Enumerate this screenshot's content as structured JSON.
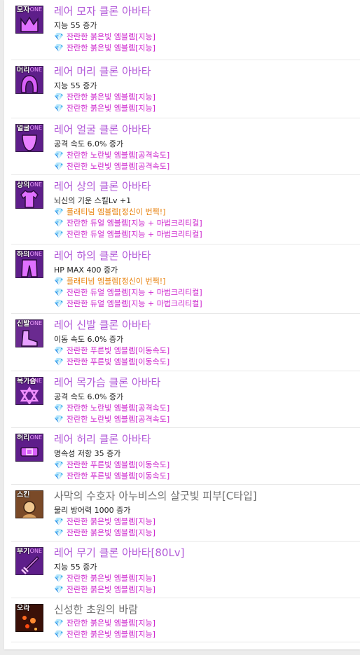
{
  "items": [
    {
      "tag": "모자",
      "name": "레어 모자 클론 아바타",
      "stat": "지능 55 증가",
      "emblems": [
        "잔란한 붉은빛 엠블렘[지능]",
        "잔란한 붉은빛 엠블렘[지능]"
      ],
      "gold": null,
      "glyph": "crown-icon",
      "gem": "pink"
    },
    {
      "tag": "머리",
      "name": "레어 머리 클론 아바타",
      "stat": "지능 55 증가",
      "emblems": [
        "잔란한 붉은빛 엠블렘[지능]",
        "잔란한 붉은빛 엠블렘[지능]"
      ],
      "gold": null,
      "glyph": "hair-icon",
      "gem": "pink"
    },
    {
      "tag": "얼굴",
      "name": "레어 얼굴 클론 아바타",
      "stat": "공격 속도 6.0% 증가",
      "emblems": [
        "찬란한 노란빛 엠블렘[공격속도]",
        "찬란한 노란빛 엠블렘[공격속도]"
      ],
      "gold": null,
      "glyph": "face-icon",
      "gem": "pink"
    },
    {
      "tag": "상의",
      "name": "레어 상의 클론 아바타",
      "stat": "뇌신의 기운 스킬Lv +1",
      "gold": "플래티넘 엠블렘[정신이 번쩍!]",
      "emblems": [
        "잔란한 듀얼 엠블렘[지능 + 마법크리티컬]",
        "잔란한 듀얼 엠블렘[지능 + 마법크리티컬]"
      ],
      "glyph": "shirt-icon",
      "gem": "pink"
    },
    {
      "tag": "하의",
      "name": "레어 하의 클론 아바타",
      "stat": "HP MAX 400 증가",
      "gold": "플래티넘 엠블렘[정신이 번쩍!]",
      "emblems": [
        "잔란한 듀얼 엠블렘[지능 + 마법크리티컬]",
        "잔란한 듀얼 엠블렘[지능 + 마법크리티컬]"
      ],
      "glyph": "pants-icon",
      "gem": "pink"
    },
    {
      "tag": "신발",
      "name": "레어 신발 클론 아바타",
      "stat": "이동 속도 6.0% 증가",
      "emblems": [
        "잔란한 푸른빛 엠블렘[이동속도]",
        "잔란한 푸른빛 엠블렘[이동속도]"
      ],
      "gold": null,
      "glyph": "shoes-icon",
      "gem": "pink"
    },
    {
      "tag": "목가슴",
      "name": "레어 목가슴 클론 아바타",
      "stat": "공격 속도 6.0% 증가",
      "emblems": [
        "잔란한 노란빛 엠블렘[공격속도]",
        "잔란한 노란빛 엠블렘[공격속도]"
      ],
      "gold": null,
      "glyph": "necklace-icon",
      "gem": "pink"
    },
    {
      "tag": "허리",
      "name": "레어 허리 클론 아바타",
      "stat": "명속성 저항 35 증가",
      "emblems": [
        "잔란한 푸른빛 엠블렘[이동속도]",
        "잔란한 푸른빛 엠블렘[이동속도]"
      ],
      "gold": null,
      "glyph": "belt-icon",
      "gem": "pink"
    },
    {
      "tag": "스킨",
      "name": "사막의 수호자 아누비스의 살굿빛 피부[C타입]",
      "stat": "물리 방어력 1000 증가",
      "emblems": [
        "잔란한 붉은빛 엠블렘[지능]",
        "잔란한 붉은빛 엠블렘[지능]"
      ],
      "gold": null,
      "glyph": "skin-icon",
      "gem": "pink",
      "plain": true
    },
    {
      "tag": "무기",
      "name": "레어 무기 클론 아바타[80Lv]",
      "stat": "지능 55 증가",
      "emblems": [
        "잔란한 붉은빛 엠블렘[지능]",
        "잔란한 붉은빛 엠블렘[지능]"
      ],
      "gold": null,
      "glyph": "weapon-icon",
      "gem": "pink"
    },
    {
      "tag": "오라",
      "name": "신성한 초원의 바람",
      "stat": null,
      "emblems": [
        "잔란한 붉은빛 엠블렘[지능]",
        "잔란한 붉은빛 엠블렘[지능]"
      ],
      "gold": null,
      "glyph": "aura-icon",
      "gem": "pink",
      "plain": true
    }
  ],
  "brand_mark": "ONE",
  "colors": {
    "name": "#b25ad8",
    "plain_name": "#6e6e6e",
    "emblem": "#cc22cc",
    "gold": "#e8820e",
    "stat": "#222222"
  }
}
